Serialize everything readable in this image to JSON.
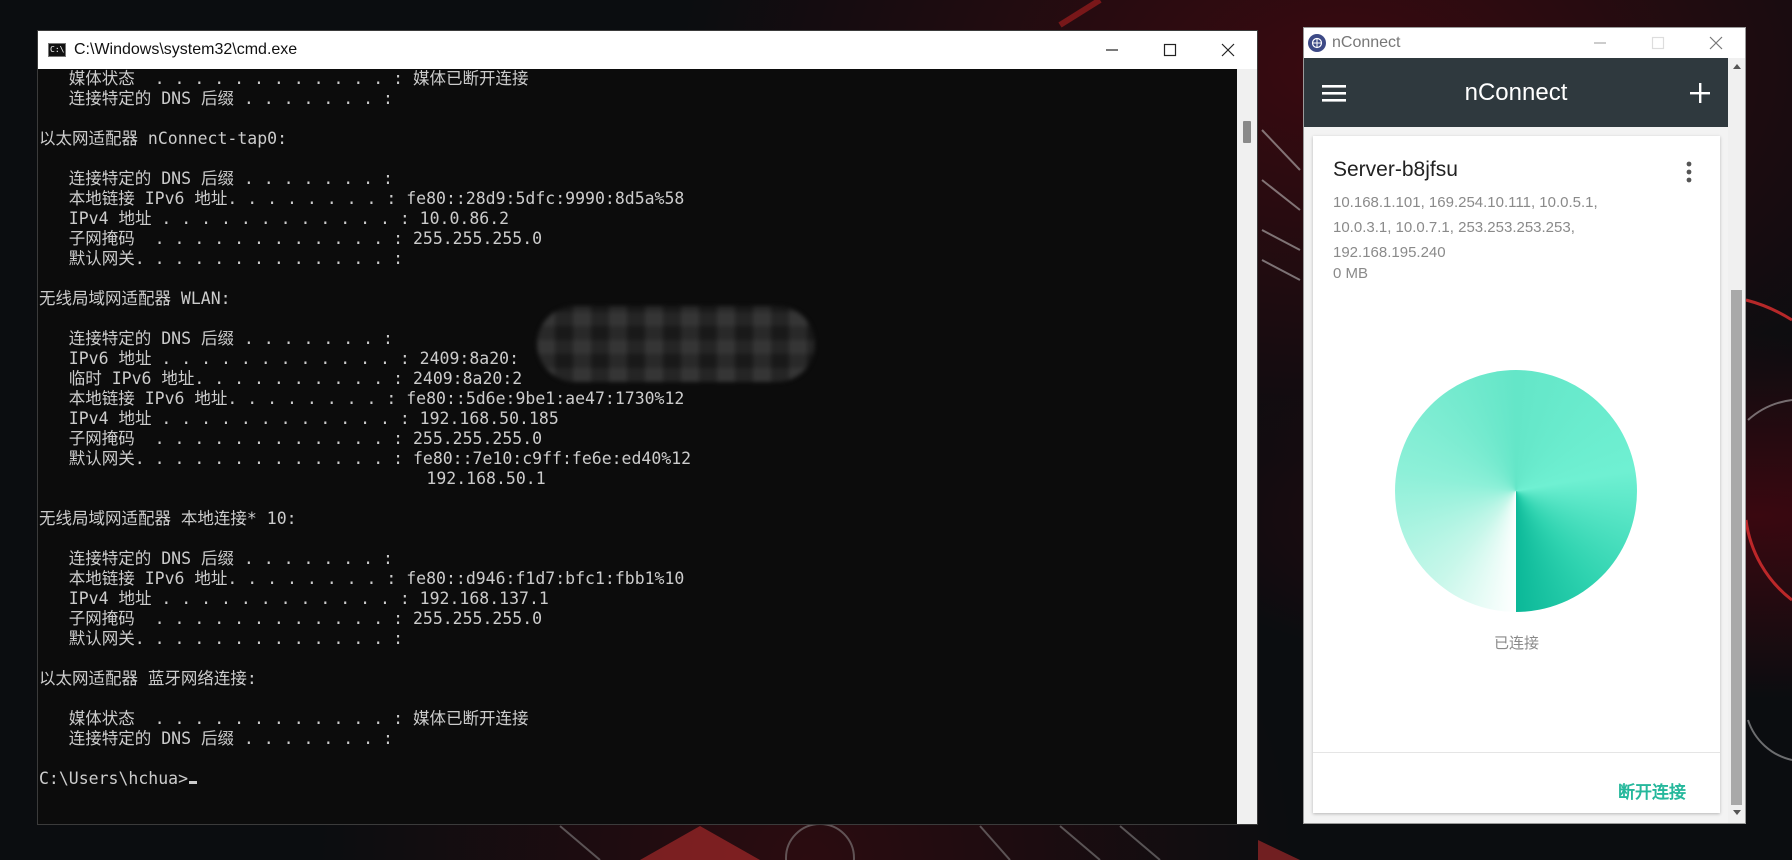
{
  "cmd": {
    "title": "C:\\Windows\\system32\\cmd.exe",
    "lines": [
      "   媒体状态  . . . . . . . . . . . . : 媒体已断开连接",
      "   连接特定的 DNS 后缀 . . . . . . . :",
      "",
      "以太网适配器 nConnect-tap0:",
      "",
      "   连接特定的 DNS 后缀 . . . . . . . :",
      "   本地链接 IPv6 地址. . . . . . . . : fe80::28d9:5dfc:9990:8d5a%58",
      "   IPv4 地址 . . . . . . . . . . . . : 10.0.86.2",
      "   子网掩码  . . . . . . . . . . . . : 255.255.255.0",
      "   默认网关. . . . . . . . . . . . . :",
      "",
      "无线局域网适配器 WLAN:",
      "",
      "   连接特定的 DNS 后缀 . . . . . . . :",
      "   IPv6 地址 . . . . . . . . . . . . : 2409:8a20:",
      "   临时 IPv6 地址. . . . . . . . . . : 2409:8a20:2",
      "   本地链接 IPv6 地址. . . . . . . . : fe80::5d6e:9be1:ae47:1730%12",
      "   IPv4 地址 . . . . . . . . . . . . : 192.168.50.185",
      "   子网掩码  . . . . . . . . . . . . : 255.255.255.0",
      "   默认网关. . . . . . . . . . . . . : fe80::7e10:c9ff:fe6e:ed40%12",
      "                                       192.168.50.1",
      "",
      "无线局域网适配器 本地连接* 10:",
      "",
      "   连接特定的 DNS 后缀 . . . . . . . :",
      "   本地链接 IPv6 地址. . . . . . . . : fe80::d946:f1d7:bfc1:fbb1%10",
      "   IPv4 地址 . . . . . . . . . . . . : 192.168.137.1",
      "   子网掩码  . . . . . . . . . . . . : 255.255.255.0",
      "   默认网关. . . . . . . . . . . . . :",
      "",
      "以太网适配器 蓝牙网络连接:",
      "",
      "   媒体状态  . . . . . . . . . . . . : 媒体已断开连接",
      "   连接特定的 DNS 后缀 . . . . . . . :",
      "",
      "C:\\Users\\hchua>"
    ]
  },
  "nconnect": {
    "window_title": "nConnect",
    "app_title": "nConnect",
    "server_name": "Server-b8jfsu",
    "addresses": "10.168.1.101, 169.254.10.111, 10.0.5.1, 10.0.3.1, 10.0.7.1, 253.253.253.253, 192.168.195.240",
    "traffic": "0 MB",
    "status": "已连接",
    "disconnect_label": "断开连接",
    "accent_color": "#26b89c"
  }
}
